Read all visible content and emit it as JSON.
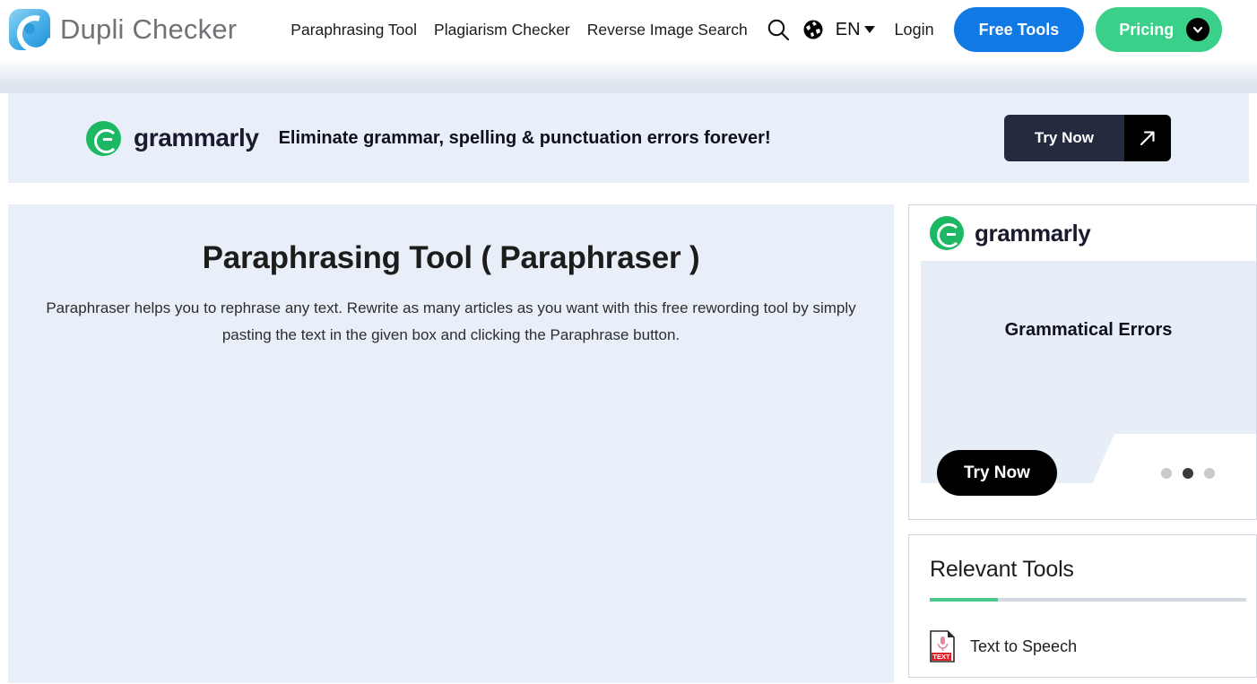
{
  "header": {
    "brand": "Dupli Checker",
    "logo_icon": "duplichecker-c-logo",
    "nav": [
      {
        "label": "Paraphrasing Tool"
      },
      {
        "label": "Plagiarism Checker"
      },
      {
        "label": "Reverse Image Search"
      }
    ],
    "search_icon": "search-icon",
    "globe_icon": "globe-icon",
    "language": "EN",
    "language_caret_icon": "chevron-down-icon",
    "login_label": "Login",
    "free_tools_label": "Free Tools",
    "pricing_label": "Pricing",
    "pricing_caret_icon": "chevron-down-icon",
    "colors": {
      "free_tools_bg": "#1179E4",
      "pricing_bg": "#3BD089",
      "brand_text": "#6f7377"
    }
  },
  "promo": {
    "logo_icon": "grammarly-logo",
    "brand": "grammarly",
    "tagline": "Eliminate grammar, spelling & punctuation errors forever!",
    "cta_label": "Try Now",
    "cta_arrow_icon": "arrow-up-right-icon",
    "bg": "#E8EFF8",
    "cta_bg": "#252B3F"
  },
  "main": {
    "title": "Paraphrasing Tool ( Paraphraser )",
    "description": "Paraphraser helps you to rephrase any text. Rewrite as many articles as you want with this free rewording tool by simply pasting the text in the given box and clicking the Paraphrase button.",
    "bg": "#E9EFF8"
  },
  "sidebar": {
    "ad": {
      "logo_icon": "grammarly-logo",
      "brand": "grammarly",
      "headline": "Grammatical Errors",
      "cta_label": "Try Now",
      "dots": [
        {
          "active": false
        },
        {
          "active": true
        },
        {
          "active": false
        }
      ]
    },
    "relevant_tools": {
      "title": "Relevant Tools",
      "accent_color": "#4CC88A",
      "items": [
        {
          "label": "Text to Speech",
          "icon": "text-to-speech-document-icon"
        }
      ]
    }
  }
}
